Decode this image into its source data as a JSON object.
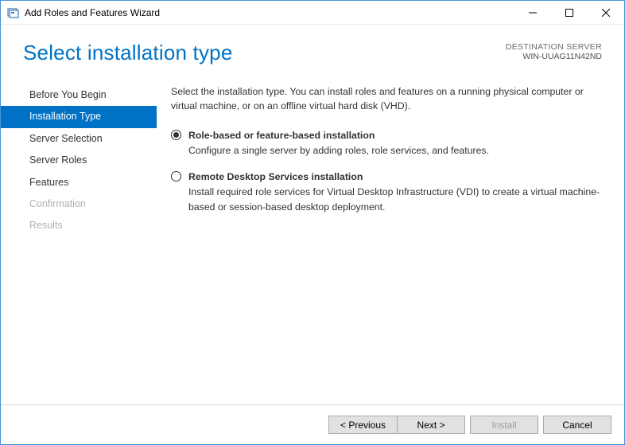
{
  "window": {
    "title": "Add Roles and Features Wizard"
  },
  "header": {
    "title": "Select installation type",
    "dest_label": "DESTINATION SERVER",
    "dest_server": "WIN-UUAG11N42ND"
  },
  "sidebar": {
    "items": [
      {
        "label": "Before You Begin",
        "state": "normal"
      },
      {
        "label": "Installation Type",
        "state": "active"
      },
      {
        "label": "Server Selection",
        "state": "normal"
      },
      {
        "label": "Server Roles",
        "state": "normal"
      },
      {
        "label": "Features",
        "state": "normal"
      },
      {
        "label": "Confirmation",
        "state": "disabled"
      },
      {
        "label": "Results",
        "state": "disabled"
      }
    ]
  },
  "content": {
    "intro": "Select the installation type. You can install roles and features on a running physical computer or virtual machine, or on an offline virtual hard disk (VHD).",
    "options": [
      {
        "title": "Role-based or feature-based installation",
        "desc": "Configure a single server by adding roles, role services, and features.",
        "checked": true
      },
      {
        "title": "Remote Desktop Services installation",
        "desc": "Install required role services for Virtual Desktop Infrastructure (VDI) to create a virtual machine-based or session-based desktop deployment.",
        "checked": false
      }
    ]
  },
  "footer": {
    "previous": "< Previous",
    "next": "Next >",
    "install": "Install",
    "cancel": "Cancel"
  }
}
